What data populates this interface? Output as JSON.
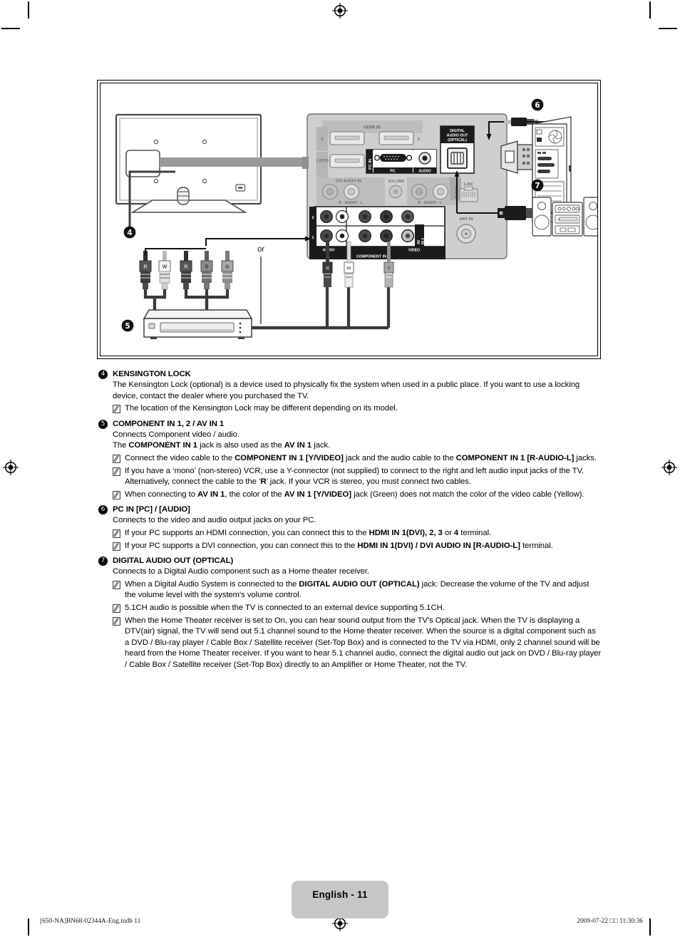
{
  "page": {
    "badge_label": "English - 11",
    "footer_left": "[650-NA]BN68-02344A-Eng.indb   11",
    "footer_right": "2009-07-22   □□ 11:30:36"
  },
  "diagram": {
    "or_label": "or",
    "markers": {
      "tv": "4",
      "dvd": "5",
      "pc": "6",
      "stereo": "7"
    },
    "panel_labels": {
      "hdmi_in": "HDMI IN",
      "hdmi_2": "2",
      "hdmi_3": "3",
      "hdmi_1_dvi": "1 (DVI)",
      "pc_in": "PC IN",
      "pc": "PC",
      "audio": "AUDIO",
      "digital_audio_out": "DIGITAL AUDIO OUT (OPTICAL)",
      "dvi_audio_in": "DVI AUDIO IN",
      "audio_lr": "R - AUDIO - L",
      "ex_link": "EX-LINK",
      "audio_out": "AUDIO OUT",
      "lan": "LAN",
      "ant_in": "ANT IN",
      "av_in_1": "AV IN 1",
      "component_in": "COMPONENT IN",
      "row_2": "2",
      "row_1": "1",
      "video": "VIDEO"
    },
    "plug_labels": {
      "av_set": [
        "R",
        "W"
      ],
      "component_set": [
        "R",
        "B",
        "G"
      ],
      "tv_side": [
        "R",
        "W",
        "Y"
      ]
    }
  },
  "sections": [
    {
      "num": "4",
      "title": "KENSINGTON LOCK",
      "paragraphs": [
        "The Kensington Lock (optional) is a device used to physically fix the system when used in a public place. If you want to use a locking device, contact the dealer where you purchased the TV."
      ],
      "notes": [
        "The location of the Kensington Lock may be different depending on its model."
      ]
    },
    {
      "num": "5",
      "title": "COMPONENT IN 1, 2 / AV IN 1",
      "paragraphs": [
        "Connects Component video / audio."
      ],
      "paragraphs_rich": [
        "The <b>COMPONENT IN 1</b> jack is also used as the <b>AV IN 1</b> jack."
      ],
      "notes_rich": [
        "Connect the video cable to the <b>COMPONENT IN 1 [Y/VIDEO]</b> jack and the audio cable to the <b>COMPONENT IN 1 [R-AUDIO-L]</b> jacks.",
        "If you have a ‘mono’ (non-stereo) VCR, use a Y-connector (not supplied) to connect to the right and left audio input jacks of the TV. Alternatively, connect the cable to the ‘<b>R</b>’ jack. If your VCR is stereo, you must connect two cables.",
        "When connecting to <b>AV IN 1</b>, the color of the <b>AV IN 1 [Y/VIDEO]</b> jack (Green) does not match the color of the video cable (Yellow)."
      ]
    },
    {
      "num": "6",
      "title": "PC IN [PC] / [AUDIO]",
      "paragraphs": [
        "Connects to the video and audio output jacks on your PC."
      ],
      "notes_rich": [
        "If your PC supports an HDMI connection, you can connect this to the <b>HDMI IN 1(DVI), 2, 3</b> or <b>4</b> terminal.",
        "If your PC supports a DVI connection, you can connect this to the <b>HDMI IN 1(DVI) / DVI AUDIO IN [R-AUDIO-L]</b> terminal."
      ]
    },
    {
      "num": "7",
      "title": "DIGITAL AUDIO OUT (OPTICAL)",
      "paragraphs": [
        "Connects to a Digital Audio component such as a Home theater receiver."
      ],
      "notes_rich": [
        "When a Digital Audio System is connected to the <b>DIGITAL AUDIO OUT (OPTICAL)</b> jack: Decrease the volume of the TV and adjust the volume level with the system's volume control.",
        "5.1CH audio is possible when the TV is connected to an external device supporting 5.1CH.",
        "When the Home Theater receiver is set to On, you can hear sound output from the TV's Optical jack. When the TV is displaying a DTV(air) signal, the TV will send out 5.1 channel sound to the Home theater receiver. When the source is a digital component such as a DVD / Blu-ray player / Cable Box / Satellite receiver (Set-Top Box) and is connected to the TV via HDMI, only 2 channel sound will be heard from the Home Theater receiver. If you want to hear 5.1 channel audio, connect the digital audio out jack on DVD / Blu-ray player / Cable Box / Satellite receiver (Set-Top Box) directly to an Amplifier or Home Theater, not the TV."
      ]
    }
  ]
}
